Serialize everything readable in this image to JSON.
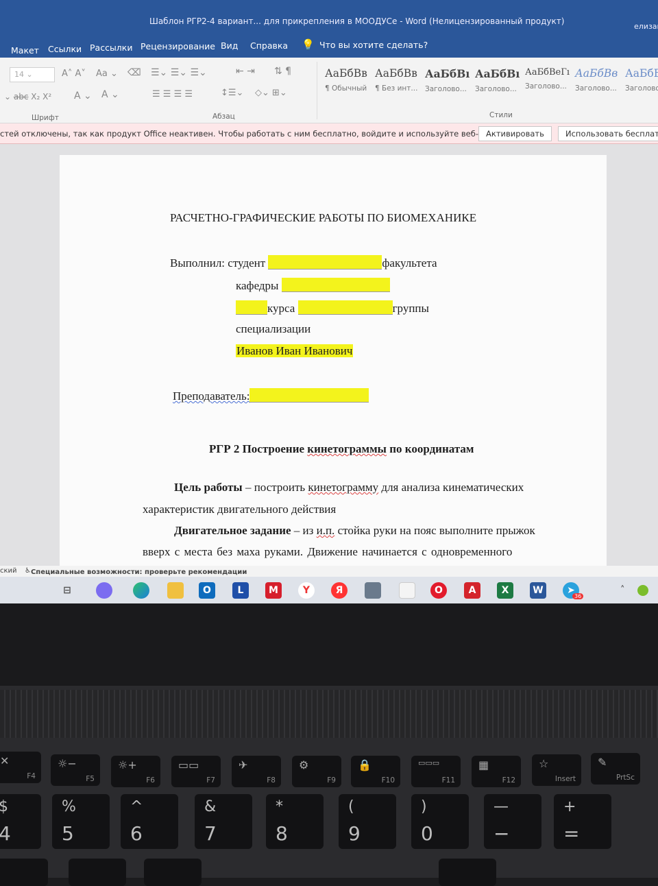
{
  "window": {
    "title": "Шаблон РГР2-4 вариант... для прикрепления в МООДУСе  -  Word (Нелицензированный продукт)",
    "user": "елизаве"
  },
  "tabs": [
    "Макет",
    "Ссылки",
    "Рассылки",
    "Рецензирование",
    "Вид",
    "Справка"
  ],
  "tell_me": "Что вы хотите сделать?",
  "ribbon": {
    "font_size": "14",
    "groups": {
      "font": "Шрифт",
      "paragraph": "Абзац",
      "styles": "Стили"
    },
    "styles": [
      {
        "sample": "АаБбВв",
        "label": "¶ Обычный"
      },
      {
        "sample": "АаБбВв",
        "label": "¶ Без инт..."
      },
      {
        "sample": "АаБбВı",
        "label": "Заголово..."
      },
      {
        "sample": "АаБбВı",
        "label": "Заголово..."
      },
      {
        "sample": "АаБбВеГı",
        "label": "Заголово..."
      },
      {
        "sample": "АаБбВв",
        "label": "Заголово..."
      },
      {
        "sample": "АаБбВ",
        "label": "Заголово"
      }
    ]
  },
  "message_bar": {
    "text": "стей отключены, так как продукт Office неактивен. Чтобы работать с ним бесплатно, войдите и используйте веб-версию.",
    "activate": "Активировать",
    "use_free": "Использовать бесплатн"
  },
  "document": {
    "heading": "РАСЧЕТНО-ГРАФИЧЕСКИЕ РАБОТЫ ПО БИОМЕХАНИКЕ",
    "done_by": "Выполнил: студент",
    "faculty": "факультета",
    "department": "кафедры",
    "course": "курса",
    "group": "группы",
    "specialization": "специализации",
    "student_name": "Иванов Иван Иванович",
    "teacher": "Преподаватель:",
    "rgr_title_prefix": "РГР 2 Построение ",
    "rgr_title_word": "кинетограммы",
    "rgr_title_suffix": " по координатам",
    "goal_label": "Цель работы",
    "goal_text1": " – построить ",
    "goal_word": "кинетограмму",
    "goal_text2": " для анализа кинематических",
    "goal_line2": "характеристик двигательного действия",
    "task_label": "Двигательное задание",
    "task_text1": " – из ",
    "task_abbr": "и.п.",
    "task_text2": " стойка руки на пояс выполните прыжок",
    "task_line2": "вверх  с  места  без  маха  руками.  Движение  начинается  с  одновременного"
  },
  "status_bar": {
    "lang": "ский",
    "accessibility": "Специальные возможности: проверьте рекомендации"
  },
  "taskbar_icons": [
    "task-view-icon",
    "alice-icon",
    "edge-icon",
    "explorer-icon",
    "outlook-icon",
    "l-app-icon",
    "mcafee-icon",
    "yandex-browser-icon",
    "yandex-icon",
    "calculator-icon",
    "file-icon",
    "opera-icon",
    "acrobat-icon",
    "excel-icon",
    "word-icon",
    "telegram-icon"
  ],
  "tray": {
    "telegram_badge": "36"
  },
  "keyboard": {
    "fn_keys": [
      {
        "top": "✕",
        "label": "F4"
      },
      {
        "top": "☼−",
        "label": "F5"
      },
      {
        "top": "☼+",
        "label": "F6"
      },
      {
        "top": "▭▭",
        "label": "F7"
      },
      {
        "top": "✈",
        "label": "F8"
      },
      {
        "top": "⚙",
        "label": "F9"
      },
      {
        "top": "🔒",
        "label": "F10"
      },
      {
        "top": "▭▭▭",
        "label": "F11"
      },
      {
        "top": "▦",
        "label": "F12"
      },
      {
        "top": "☆",
        "label": "Insert"
      },
      {
        "top": "✎",
        "label": "PrtSc"
      }
    ],
    "num_keys": [
      {
        "top": "$",
        "main": "4"
      },
      {
        "top": "%",
        "main": "5"
      },
      {
        "top": "^",
        "main": "6"
      },
      {
        "top": "&",
        "main": "7"
      },
      {
        "top": "*",
        "main": "8"
      },
      {
        "top": "(",
        "main": "9"
      },
      {
        "top": ")",
        "main": "0"
      },
      {
        "top": "—",
        "main": "−"
      },
      {
        "top": "+",
        "main": "="
      }
    ]
  }
}
